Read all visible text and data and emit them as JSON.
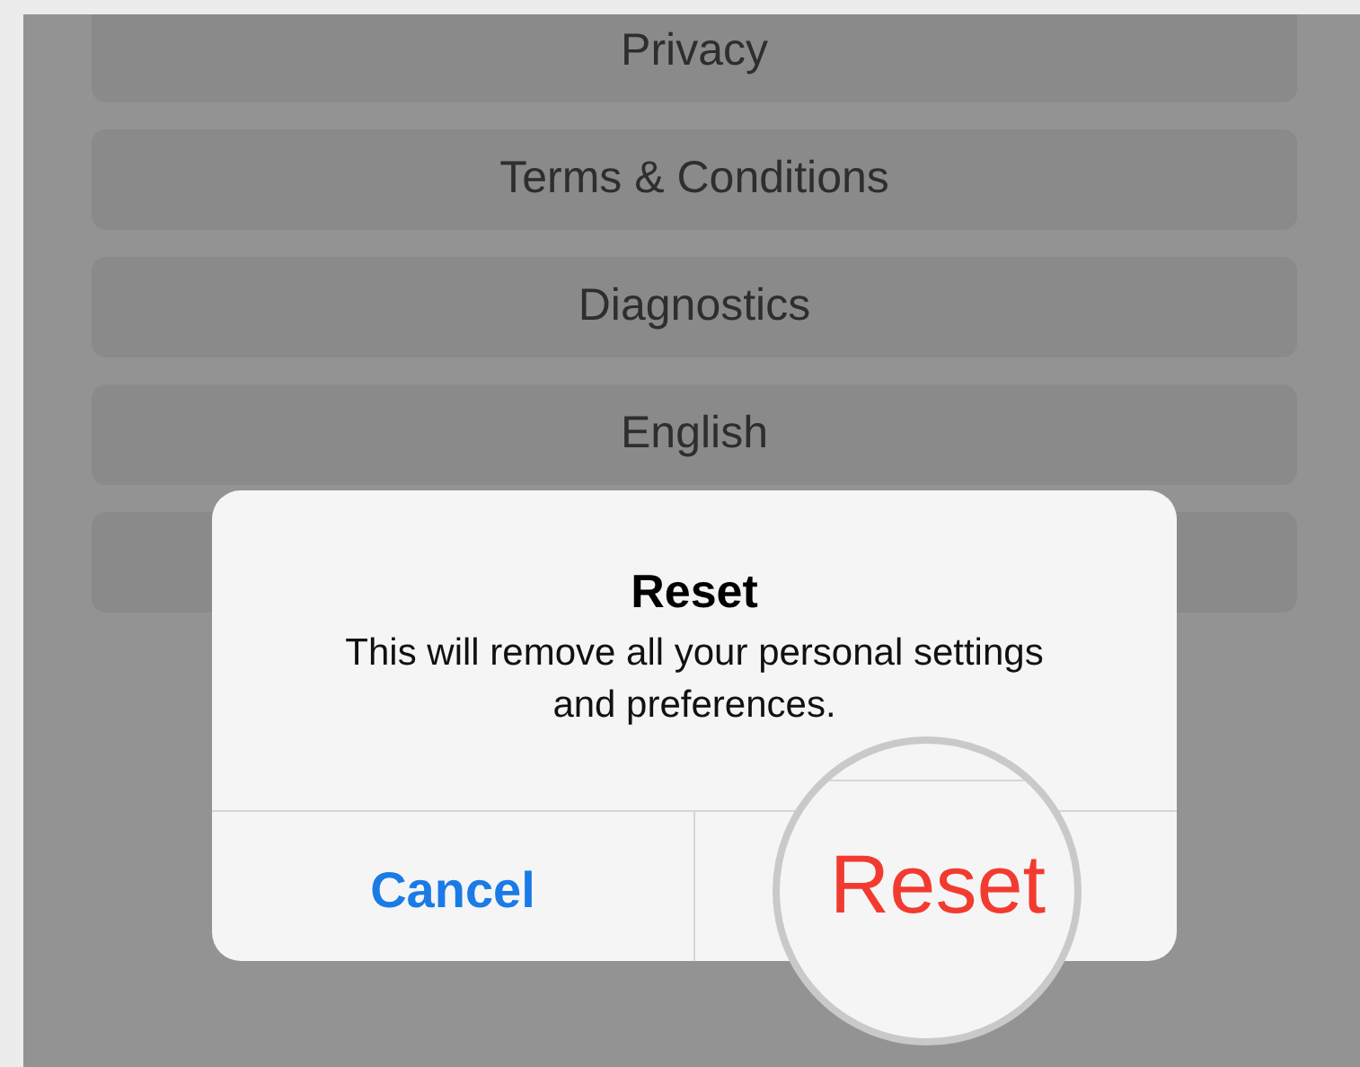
{
  "settings_items": [
    {
      "label": "Privacy"
    },
    {
      "label": "Terms & Conditions"
    },
    {
      "label": "Diagnostics"
    },
    {
      "label": "English"
    }
  ],
  "alert": {
    "title": "Reset",
    "message": "This will remove all your personal settings and preferences.",
    "buttons": [
      {
        "label": "Cancel",
        "kind": "cancel"
      },
      {
        "label": "Reset",
        "kind": "destructive"
      }
    ]
  }
}
